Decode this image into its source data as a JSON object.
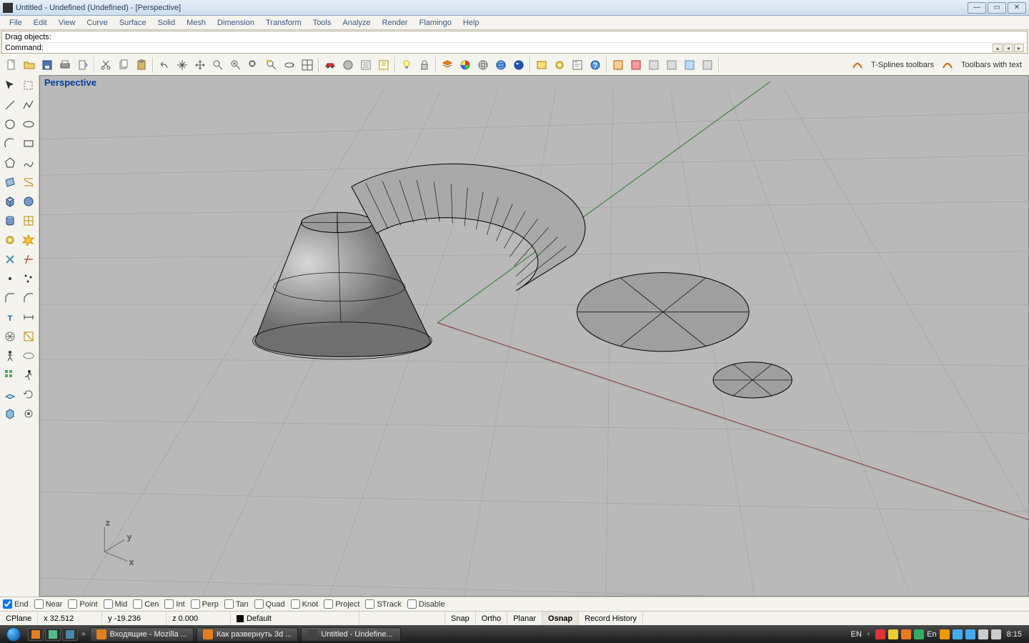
{
  "titlebar": {
    "title": "Untitled - Undefined (Undefined) - [Perspective]"
  },
  "menu": [
    "File",
    "Edit",
    "View",
    "Curve",
    "Surface",
    "Solid",
    "Mesh",
    "Dimension",
    "Transform",
    "Tools",
    "Analyze",
    "Render",
    "Flamingo",
    "Help"
  ],
  "command": {
    "line1": "Drag objects:",
    "line2": "Command:"
  },
  "toolbar_text": {
    "tsplines": "T-Splines toolbars",
    "withtext": "Toolbars with text"
  },
  "viewport": {
    "label": "Perspective",
    "axes": {
      "x": "x",
      "y": "y",
      "z": "z"
    }
  },
  "osnap": {
    "end": "End",
    "near": "Near",
    "point": "Point",
    "mid": "Mid",
    "cen": "Cen",
    "int": "Int",
    "perp": "Perp",
    "tan": "Tan",
    "quad": "Quad",
    "knot": "Knot",
    "project": "Project",
    "strack": "STrack",
    "disable": "Disable",
    "checked": {
      "end": true
    }
  },
  "status": {
    "cplane": "CPlane",
    "x": "x 32.512",
    "y": "y -19.236",
    "z": "z 0.000",
    "layer": "Default",
    "snap": "Snap",
    "ortho": "Ortho",
    "planar": "Planar",
    "osnap": "Osnap",
    "record": "Record History"
  },
  "taskbar": {
    "items": [
      {
        "label": "Входящие - Mozilla ...",
        "kind": "ff"
      },
      {
        "label": "Как развернуть 3d ...",
        "kind": "ff"
      },
      {
        "label": "Untitled - Undefine...",
        "kind": "rh"
      }
    ],
    "lang": "EN",
    "clock": "8:15",
    "en2": "En"
  }
}
